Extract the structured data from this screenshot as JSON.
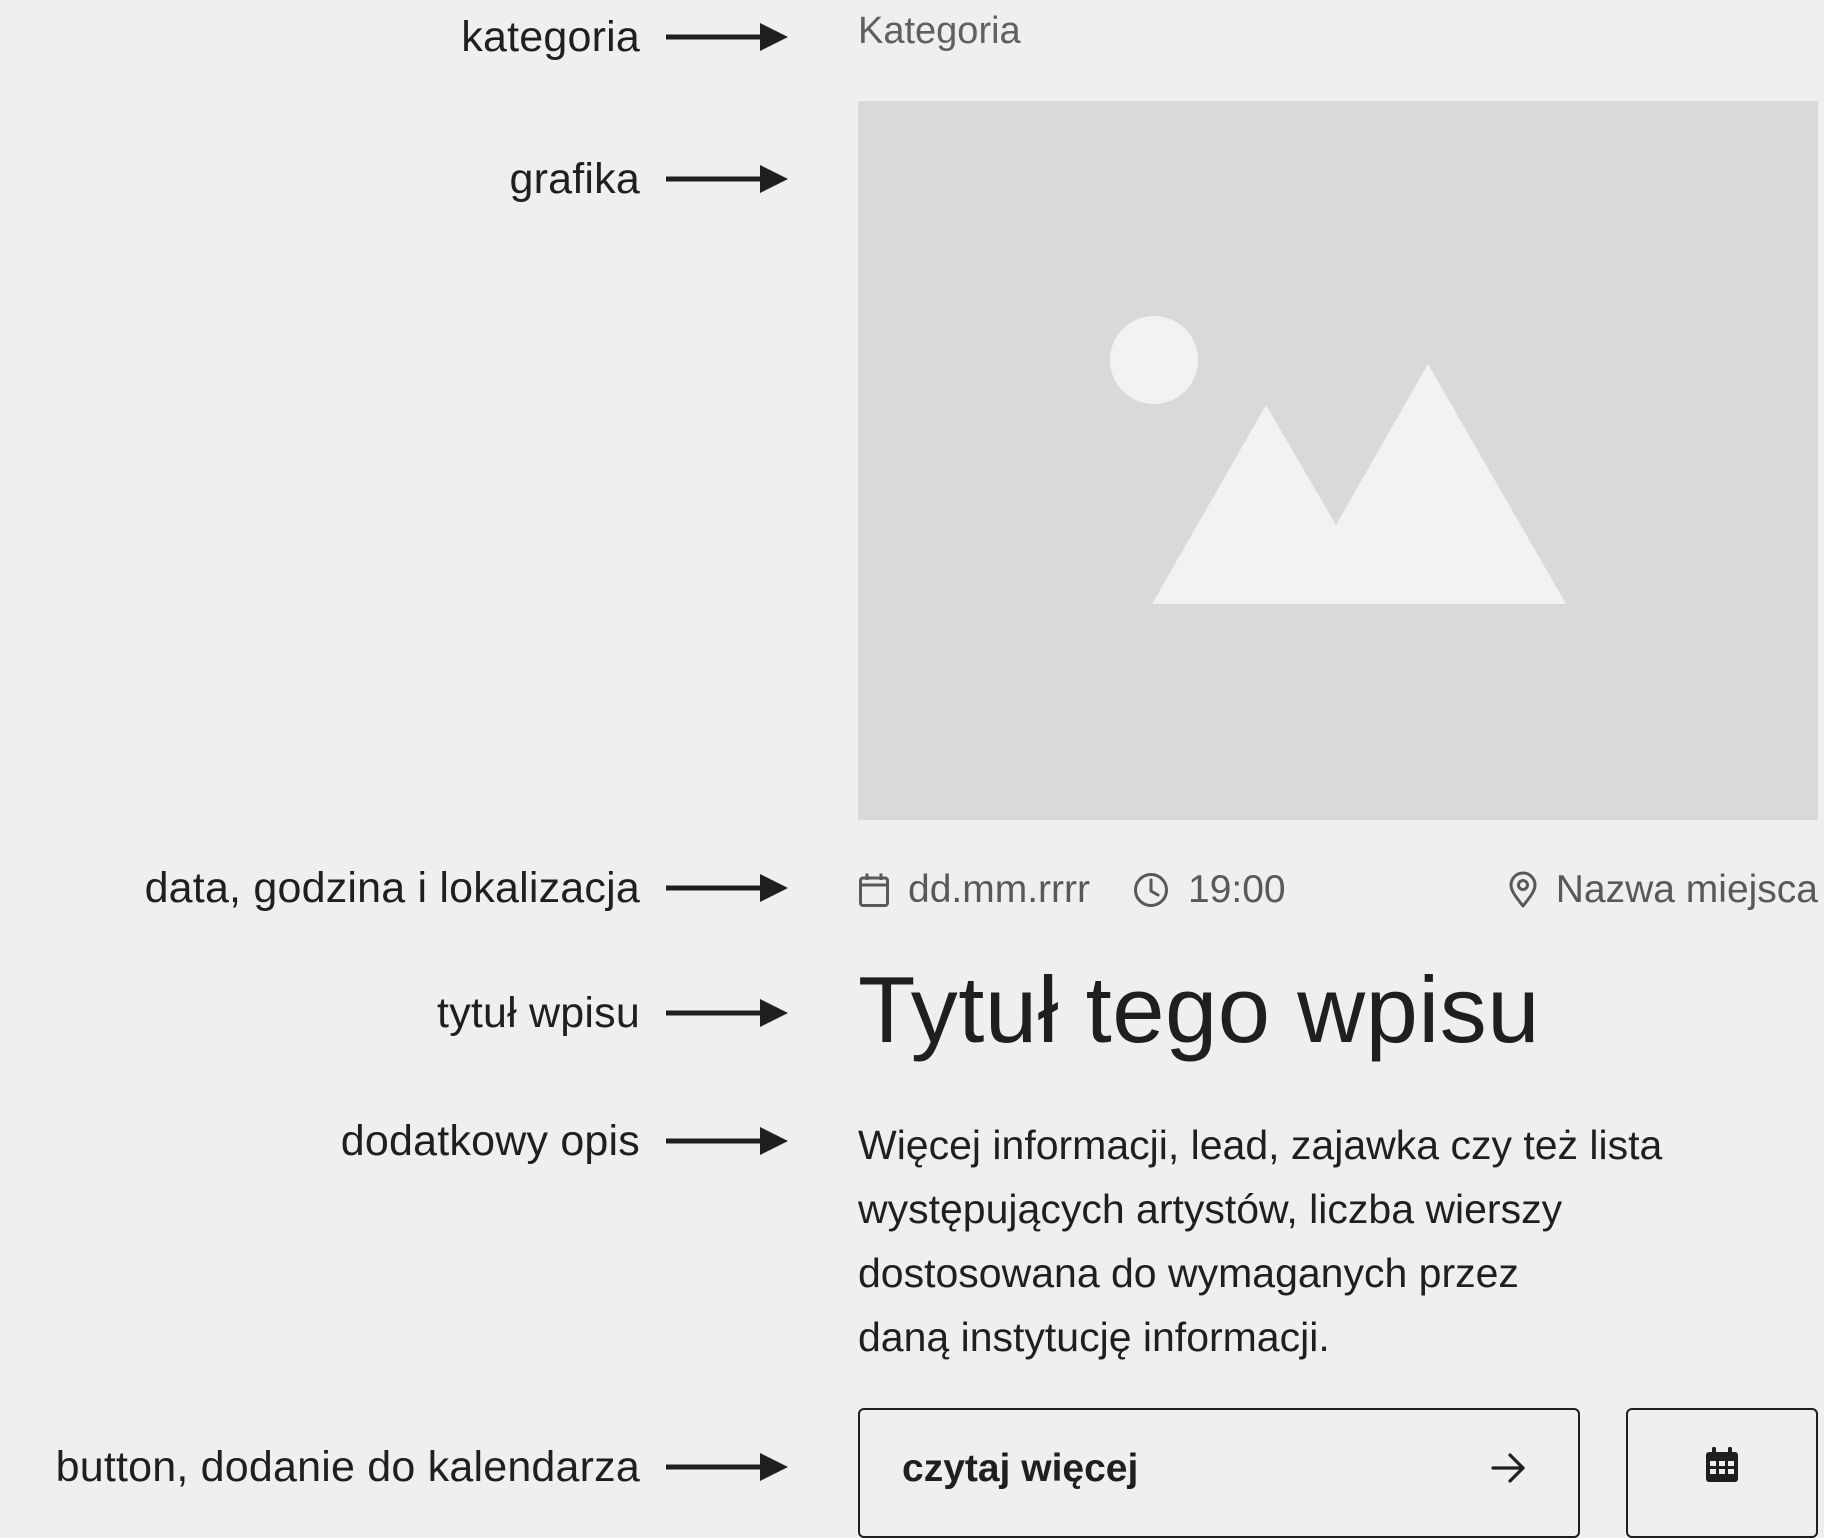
{
  "annotations": [
    {
      "id": "kategoria",
      "label": "kategoria"
    },
    {
      "id": "grafika",
      "label": "grafika"
    },
    {
      "id": "meta",
      "label": "data, godzina i lokalizacja"
    },
    {
      "id": "tytul",
      "label": "tytuł wpisu"
    },
    {
      "id": "opis",
      "label": "dodatkowy opis"
    },
    {
      "id": "button",
      "label": "button, dodanie do kalendarza"
    }
  ],
  "card": {
    "category": "Kategoria",
    "image_icon": "image-placeholder-icon",
    "date": "dd.mm.rrrr",
    "time": "19:00",
    "place": "Nazwa miejsca",
    "title": "Tytuł tego wpisu",
    "lead_lines": [
      "Więcej informacji, lead, zajawka czy też lista",
      "występujących artystów, liczba wierszy",
      "dostosowana do wymaganych przez",
      "daną instytucję informacji."
    ],
    "read_more_label": "czytaj więcej",
    "read_more_icon": "arrow-right-icon",
    "calendar_button_icon": "calendar-grid-icon"
  },
  "colors": {
    "background": "#efefef",
    "text": "#1f1f1f",
    "muted_text": "#595959",
    "placeholder": "#d9d9d9",
    "placeholder_shapes": "#f2f2f2"
  }
}
